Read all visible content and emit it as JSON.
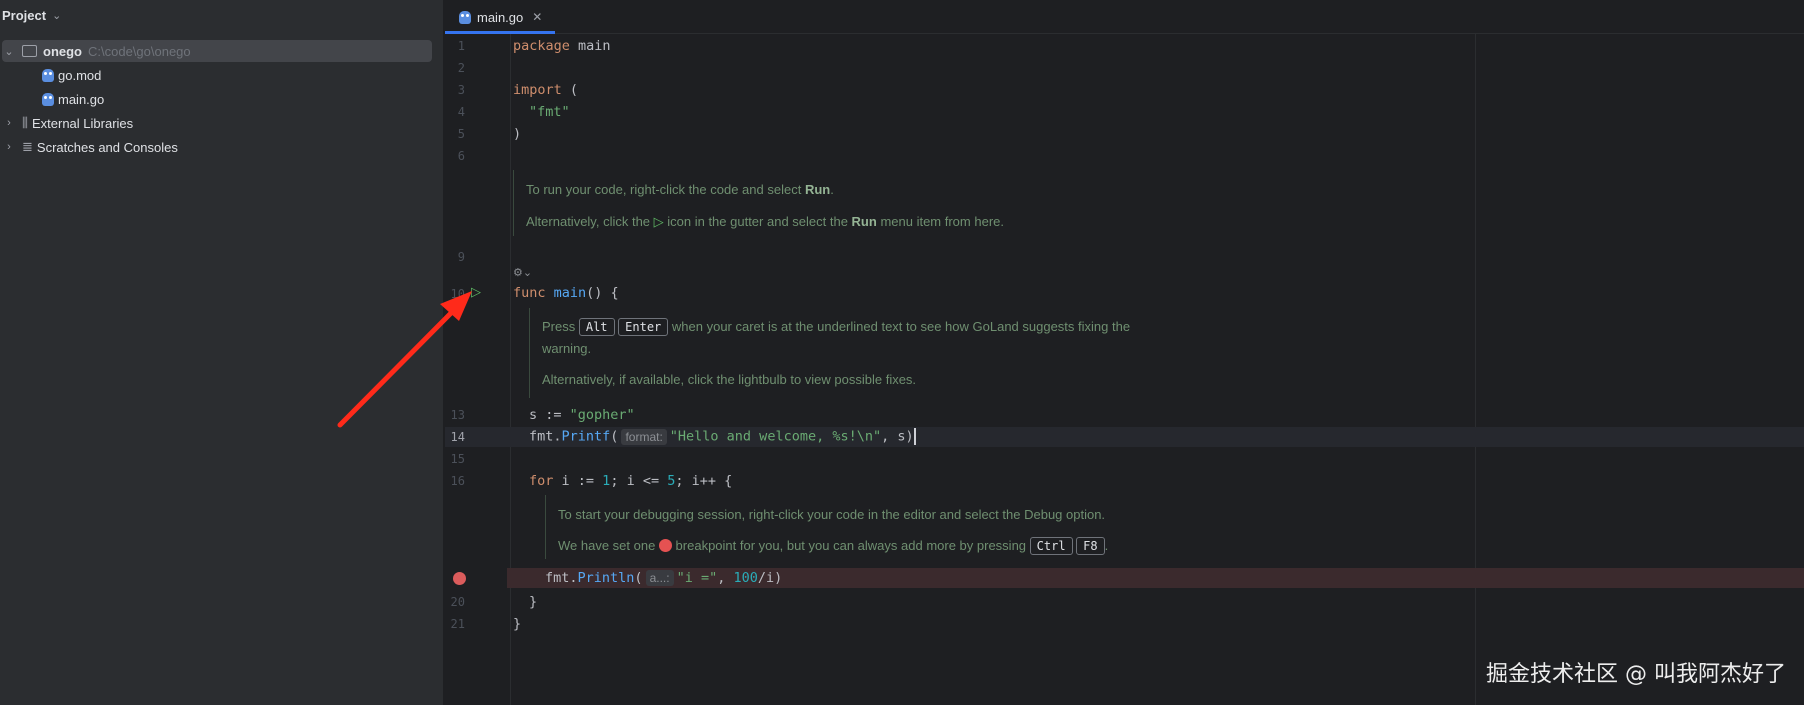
{
  "project": {
    "title": "Project",
    "tree": [
      {
        "label": "onego",
        "path": "C:\\code\\go\\onego"
      },
      {
        "label": "go.mod"
      },
      {
        "label": "main.go"
      },
      {
        "label": "External Libraries"
      },
      {
        "label": "Scratches and Consoles"
      }
    ]
  },
  "tab": {
    "label": "main.go"
  },
  "gutter": [
    "1",
    "2",
    "3",
    "4",
    "5",
    "6",
    "9",
    "10",
    "13",
    "14",
    "15",
    "16",
    "20",
    "21"
  ],
  "code": {
    "l1_kw": "package",
    "l1_rest": " main",
    "l3_kw": "import",
    "l3_rest": " (",
    "l4": "\"fmt\"",
    "l5": ")",
    "l10_kw": "func",
    "l10_fn": "main",
    "l10_rest": "() {",
    "l13_a": "s := ",
    "l13_str": "\"gopher\"",
    "l14_a": "fmt.",
    "l14_fn": "Printf",
    "l14_b": "(",
    "l14_hint": "format:",
    "l14_str": "\"Hello and welcome, %s!\\n\"",
    "l14_c": ", s)",
    "l16_kw": "for",
    "l16_a": " i := ",
    "l16_n1": "1",
    "l16_b": "; i <= ",
    "l16_n2": "5",
    "l16_c": "; i++ {",
    "l19_a": "fmt.",
    "l19_fn": "Println",
    "l19_b": "(",
    "l19_hint": "a...:",
    "l19_str": "\"i =\"",
    "l19_c": ", ",
    "l19_num": "100",
    "l19_d": "/i)",
    "l20": "}",
    "l21": "}"
  },
  "docs": {
    "run1_a": "To run your code, right-click the code and select ",
    "run1_b": "Run",
    "run1_c": ".",
    "run2_a": "Alternatively, click the ",
    "run2_b": " icon in the gutter and select the ",
    "run2_c": "Run",
    "run2_d": " menu item from here.",
    "fix1_a": "Press ",
    "fix1_k1": "Alt",
    "fix1_k2": "Enter",
    "fix1_b": " when your caret is at the underlined text to see how GoLand suggests fixing the",
    "fix1_c": "warning.",
    "fix2": "Alternatively, if available, click the lightbulb to view possible fixes.",
    "dbg1": "To start your debugging session, right-click your code in the editor and select the Debug option.",
    "dbg2_a": "We have set one ",
    "dbg2_b": " breakpoint for you, but you can always add more by pressing ",
    "dbg2_k1": "Ctrl",
    "dbg2_k2": "F8",
    "dbg2_c": "."
  },
  "icons": {
    "run": "play-icon",
    "breakpoint": "breakpoint-icon",
    "folder": "folder-icon",
    "gopher": "gopher-file-icon"
  },
  "colors": {
    "keyword": "#cf8e6d",
    "string": "#6aab73",
    "number": "#2aacb8",
    "function": "#56a8f5",
    "breakpoint": "#db5c5c",
    "run": "#5fb865",
    "annotation_arrow": "#ff2a1a"
  },
  "watermark": "掘金技术社区 @ 叫我阿杰好了"
}
